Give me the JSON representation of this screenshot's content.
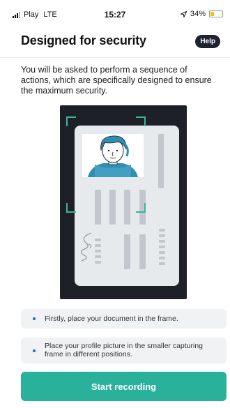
{
  "status_bar": {
    "carrier": "Play",
    "network": "LTE",
    "time": "15:27",
    "battery": "34%",
    "battery_level": 0.34,
    "location_icon": "location-arrow-icon",
    "signal_icon": "cellular-signal-icon",
    "battery_icon": "battery-icon"
  },
  "header": {
    "title": "Designed for security",
    "help_label": "Help"
  },
  "description": "You will be asked to perform a sequence of actions, which are specifically designed to ensure the maximum security.",
  "illustration": {
    "name": "id-card-in-frame-illustration",
    "signature": "Lianl"
  },
  "info_items": [
    {
      "text": "Firstly, place your document in the frame."
    },
    {
      "text": "Place your profile picture in the smaller capturing frame in different positions."
    }
  ],
  "start_button_label": "Start recording",
  "colors": {
    "accent": "#2ab19c",
    "help_button": "#1d2230",
    "bullet": "#2f5fd0",
    "battery_fill": "#f2c200",
    "illustration_bg": "#1e2027"
  }
}
